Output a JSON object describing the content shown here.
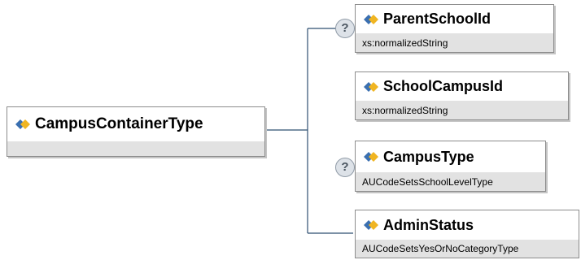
{
  "diagram": {
    "root": {
      "name": "CampusContainerType"
    },
    "children": [
      {
        "name": "ParentSchoolId",
        "type": "xs:normalizedString",
        "optional_badge": "?"
      },
      {
        "name": "SchoolCampusId",
        "type": "xs:normalizedString",
        "optional_badge": ""
      },
      {
        "name": "CampusType",
        "type": "AUCodeSetsSchoolLevelType",
        "optional_badge": "?"
      },
      {
        "name": "AdminStatus",
        "type": "AUCodeSetsYesOrNoCategoryType",
        "optional_badge": ""
      }
    ]
  },
  "icons": {
    "element_icon": "xsd-element-icon",
    "optional_icon": "question-mark-icon"
  },
  "colors": {
    "connector": "#2f4f72",
    "node_border": "#8c8c8c",
    "node_footer": "#e2e2e2",
    "icon_blue": "#3a6fb0",
    "icon_yellow": "#f0b522"
  }
}
